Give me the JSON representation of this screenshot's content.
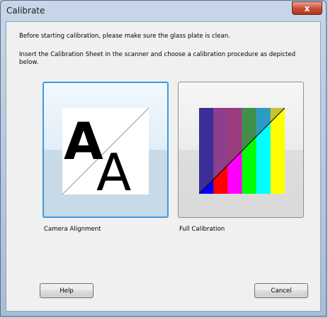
{
  "window": {
    "title": "Calibrate",
    "close_glyph": "x",
    "close_icon": "close-icon"
  },
  "instructions": {
    "line1": "Before starting calibration, please make sure the glass plate is clean.",
    "line2a": "Insert the Calibration Sheet in the scanner and choose a calibration procedure as depicted",
    "line2b": "below."
  },
  "options": [
    {
      "label": "Camera Alignment",
      "icon": "camera-alignment-icon",
      "glyph": "A",
      "selected": true
    },
    {
      "label": "Full Calibration",
      "icon": "full-calibration-icon",
      "selected": false,
      "stripes": [
        "#3b2e96",
        "#8c3f8a",
        "#9b3c7f",
        "#3f8f4b",
        "#2f9bc4",
        "#c9c236"
      ],
      "bottom_stripes": [
        "#0000ff",
        "#ff0000",
        "#ff00ff",
        "#00ff00",
        "#00ffff",
        "#ffff00"
      ]
    }
  ],
  "buttons": {
    "help": "Help",
    "cancel": "Cancel"
  }
}
